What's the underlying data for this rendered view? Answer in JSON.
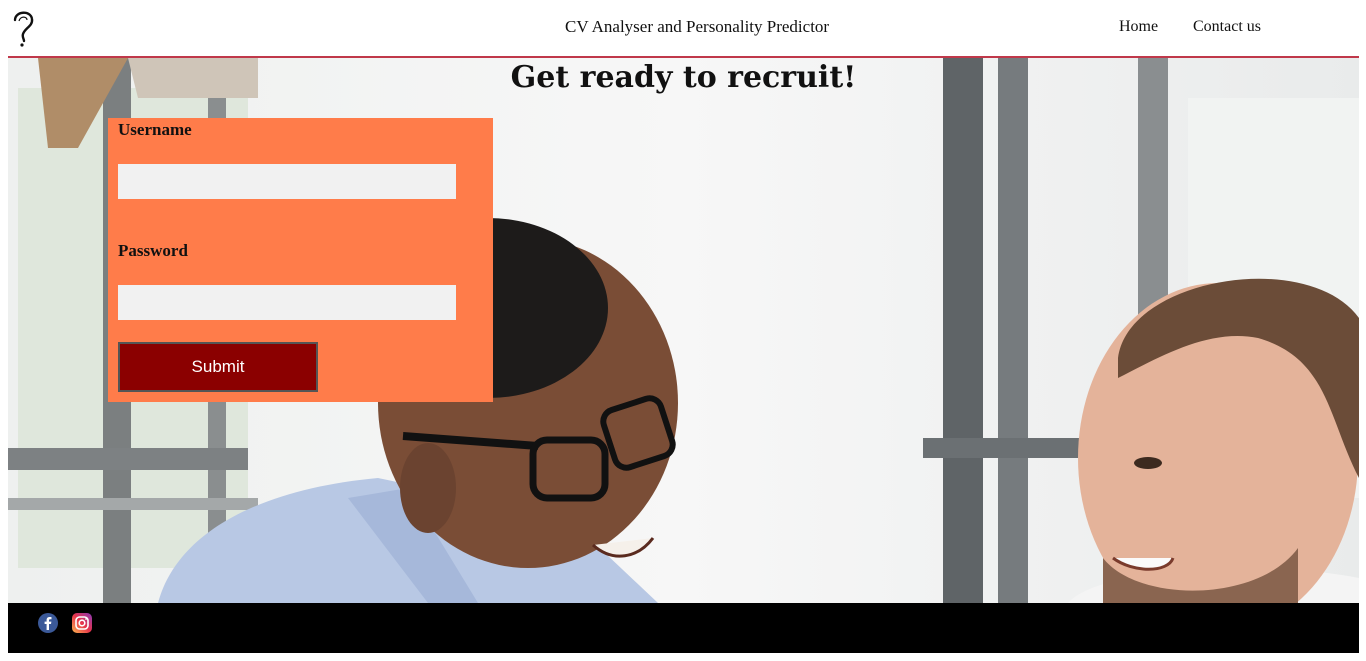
{
  "header": {
    "site_title": "CV Analyser and Personality Predictor",
    "nav": {
      "home": "Home",
      "contact": "Contact us"
    }
  },
  "hero": {
    "heading": "Get ready to recruit!"
  },
  "login": {
    "username_label": "Username",
    "username_value": "",
    "password_label": "Password",
    "password_value": "",
    "submit_label": "Submit"
  },
  "footer": {
    "social": [
      "facebook-icon",
      "instagram-icon"
    ]
  },
  "colors": {
    "accent_rule": "#c0384a",
    "form_bg": "#ff7c4a",
    "submit_bg": "#8b0000",
    "footer_bg": "#000000"
  }
}
